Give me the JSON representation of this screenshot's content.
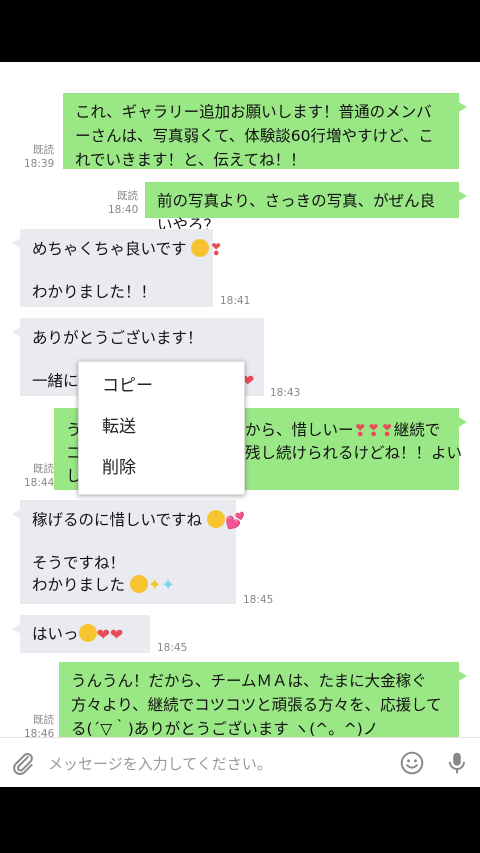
{
  "messages": [
    {
      "text": "これ、ギャラリー追加お願いします！普通のメンバーさんは、写真弱くて、体験談60行増やすけど、これでいきます！と、伝えてね！！",
      "read": "既読",
      "time": "18:39"
    },
    {
      "text": "前の写真より、さっきの写真、がぜん良いやろ？",
      "read": "既読",
      "time": "18:40"
    },
    {
      "text_line1": "めちゃくちゃ良いです",
      "text_line2": "わかりました！！",
      "time": "18:41"
    },
    {
      "text_line1": "ありがとうございます！",
      "text_line2": "一緒に",
      "time": "18:43"
    },
    {
      "text_left": "う",
      "text_right_1": "から、惜しいー",
      "text_right_1b": "継続で",
      "text_left_2": "コ",
      "text_right_2": "残し続けられるけどね！！よい",
      "text_left_3": "し",
      "read": "既読",
      "time": "18:44"
    },
    {
      "text_line1": "稼げるのに惜しいですね",
      "text_line2": "そうですね！",
      "text_line3": "わかりました",
      "time": "18:45"
    },
    {
      "text": "はいっ",
      "time": "18:45"
    },
    {
      "text": "うんうん！だから、チームＭＡは、たまに大金稼ぐ方々より、継続でコツコツと頑張る方々を、応援してる(´▽｀)ありがとうございます ヽ(^。^)ノ",
      "read": "既読",
      "time": "18:46"
    }
  ],
  "context_menu": {
    "copy": "コピー",
    "forward": "転送",
    "delete": "削除"
  },
  "input": {
    "placeholder": "メッセージを入力してください。"
  },
  "icons": {
    "attach": "paperclip-icon",
    "emoji": "emoji-icon",
    "mic": "microphone-icon"
  },
  "colors": {
    "outgoing": "#9ae885",
    "incoming": "#eaebf0"
  }
}
